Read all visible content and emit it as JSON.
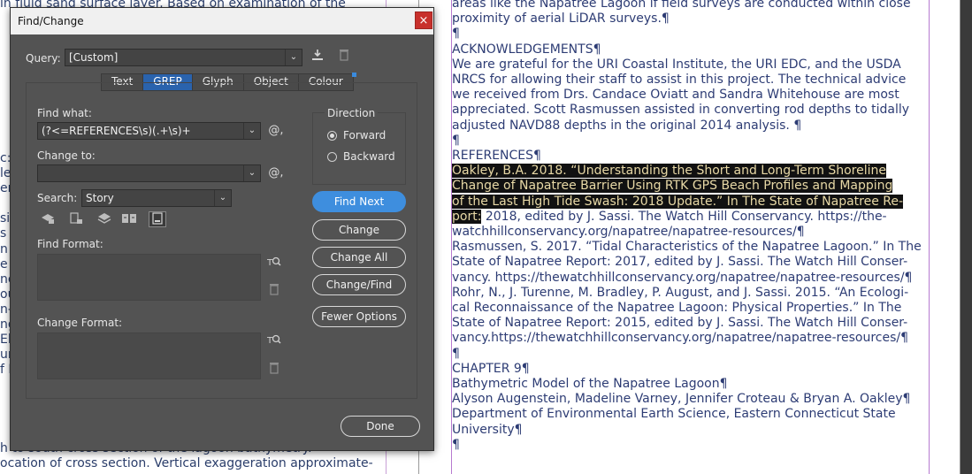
{
  "left_page": {
    "lines": [
      "in fluid sand surface layer. Based on examination of the",
      "c: n",
      "le re",
      "en",
      "si",
      "s",
      "n",
      "e p",
      "ne",
      "ou",
      "n-",
      "ng",
      "Ele",
      "ur",
      "f E",
      "h to south cross section of the lagoon bathymetry.",
      "ocation of cross section. Vertical exaggeration approximate-"
    ]
  },
  "right_page": {
    "paragraphs": [
      "areas like the Napatree Lagoon if field surveys are conducted within close",
      "proximity of aerial LiDAR surveys.¶",
      "¶",
      "ACKNOWLEDGEMENTS¶",
      "We are grateful for the URI Coastal Institute, the URI EDC, and the USDA",
      "NRCS for allowing their staff to assist in this project. The technical advice",
      "we received from Drs. Candace Oviatt and Sandra Whitehouse are most",
      "appreciated. Scott Rasmussen assisted in converting rod depths to tidally",
      "adjusted NAVD88 depths in the original 2014 analysis. ¶",
      "¶",
      "REFERENCES¶"
    ],
    "highlight_lines": [
      "Oakley, B.A. 2018. “Understanding the Short and Long-Term Shoreline",
      "Change of Napatree Barrier Using RTK GPS Beach Profiles and Mapping",
      "of the Last High Tide Swash: 2018 Update.” In The State of Napatree Re-",
      "port:"
    ],
    "after_highlight": " 2018, edited by J. Sassi. The Watch Hill Conservancy. https://the-",
    "paragraphs_after": [
      "watchhillconservancy.org/napatree/napatree-resources/¶",
      "Rasmussen, S. 2017. “Tidal Characteristics of the Napatree Lagoon.” In The",
      "State of Napatree Report: 2017, edited by J. Sassi. The Watch Hill Conser-",
      "vancy. https://thewatchhillconservancy.org/napatree/napatree-resources/¶",
      "Rohr, N., J. Turenne, M. Bradley, P. August, and J. Sassi. 2015. “An Ecologi-",
      "cal Reconnaissance of the Napatree Lagoon: Physical Properties.” In The",
      "State of Napatree Report: 2015, edited by J. Sassi. The Watch Hill Conser-",
      "vancy.https://thewatchhillconservancy.org/napatree/napatree-resources/¶",
      "¶",
      "",
      "CHAPTER 9¶",
      "Bathymetric Model of the Napatree Lagoon¶",
      "Alyson Augenstein, Madeline Varney, Jennifer Croteau & Bryan A. Oakley¶",
      "Department of Environmental Earth Science, Eastern Connecticut State",
      "University¶",
      "¶"
    ]
  },
  "dialog": {
    "title": "Find/Change",
    "close_glyph": "×",
    "query_label": "Query:",
    "query_value": "[Custom]",
    "tabs": [
      "Text",
      "GREP",
      "Glyph",
      "Object",
      "Colour"
    ],
    "find_what_label": "Find what:",
    "find_what_value": "(?<=REFERENCES\\s)(.+\\s)+",
    "change_to_label": "Change to:",
    "change_to_value": "",
    "search_label": "Search:",
    "search_value": "Story",
    "find_format_label": "Find Format:",
    "change_format_label": "Change Format:",
    "direction_label": "Direction",
    "forward_label": "Forward",
    "backward_label": "Backward",
    "direction_selected": "Forward",
    "buttons": {
      "find_next": "Find Next",
      "change": "Change",
      "change_all": "Change All",
      "change_find": "Change/Find",
      "fewer_options": "Fewer Options",
      "done": "Done"
    },
    "at_symbol": "@,"
  },
  "colors": {
    "dialog_bg": "#535353",
    "accent": "#3e8ede",
    "tab_active": "#2a63ad",
    "close_red": "#c8302c",
    "text_navy": "#2d3c74"
  }
}
